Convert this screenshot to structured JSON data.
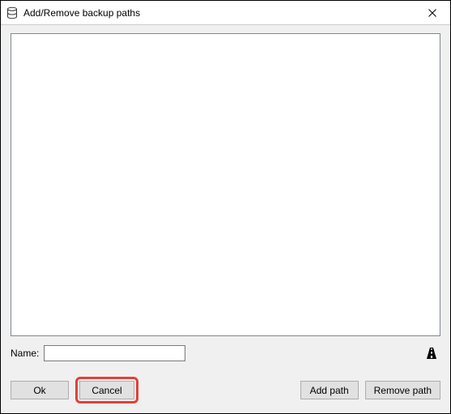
{
  "window": {
    "title": "Add/Remove backup paths"
  },
  "form": {
    "name_label": "Name:",
    "name_value": ""
  },
  "buttons": {
    "ok": "Ok",
    "cancel": "Cancel",
    "add_path": "Add path",
    "remove_path": "Remove path"
  }
}
